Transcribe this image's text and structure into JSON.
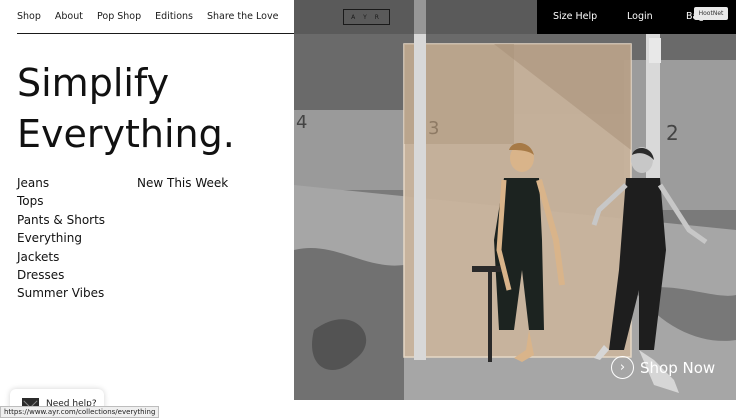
{
  "nav": {
    "items": [
      "Shop",
      "About",
      "Pop Shop",
      "Editions",
      "Share the Love"
    ]
  },
  "logo": "A Y R",
  "right_nav": {
    "size_help": "Size Help",
    "login": "Login",
    "bag": "Bag"
  },
  "badge": "HootNet",
  "hero": {
    "headline_line1": "Simplify",
    "headline_line2": "Everything.",
    "cta": "Shop Now",
    "wall_numbers": [
      "4",
      "3",
      "2"
    ]
  },
  "categories": [
    "Jeans",
    "Tops",
    "Pants & Shorts",
    "Everything",
    "Jackets",
    "Dresses",
    "Summer Vibes"
  ],
  "new_this_week": "New This Week",
  "help": "Need help?",
  "status_url": "https://www.ayr.com/collections/everything",
  "colors": {
    "text": "#111111",
    "header_right_bg": "#000000",
    "hero_white": "#ffffff"
  }
}
